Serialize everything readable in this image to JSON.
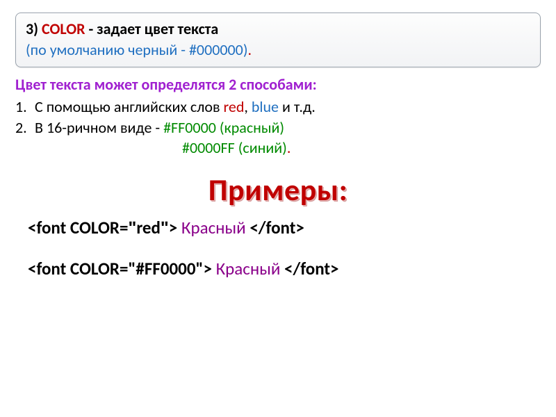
{
  "def_box": {
    "num": "3)",
    "kw": "COLOR",
    "suffix": " - задает цвет текста",
    "line2_pre": " (по умолчанию черный - #000000)",
    "line2_dot": "."
  },
  "intro": "Цвет текста может определятся 2 способами:",
  "items": [
    {
      "num": "1.",
      "pre": "С помощью английских слов ",
      "red": "red",
      "mid": ", ",
      "blue": "blue",
      "post": " и т.д."
    },
    {
      "num": "2.",
      "pre": "В 16-ричном виде - ",
      "hex1": "#FF0000 (красный)",
      "hex2_pre": "#0000FF (синий)",
      "hex2_dot": "."
    }
  ],
  "examples_title": "Примеры:",
  "code": [
    {
      "open": "<font COLOR=",
      "q": "ʺ",
      "val": "red",
      "close_attr": "> ",
      "text": "Красный",
      "close": " </font>"
    },
    {
      "open": "<font COLOR=",
      "q": "\"",
      "val": "#FF0000",
      "close_attr": "\"> ",
      "text": "Красный",
      "close": " </font>"
    }
  ]
}
